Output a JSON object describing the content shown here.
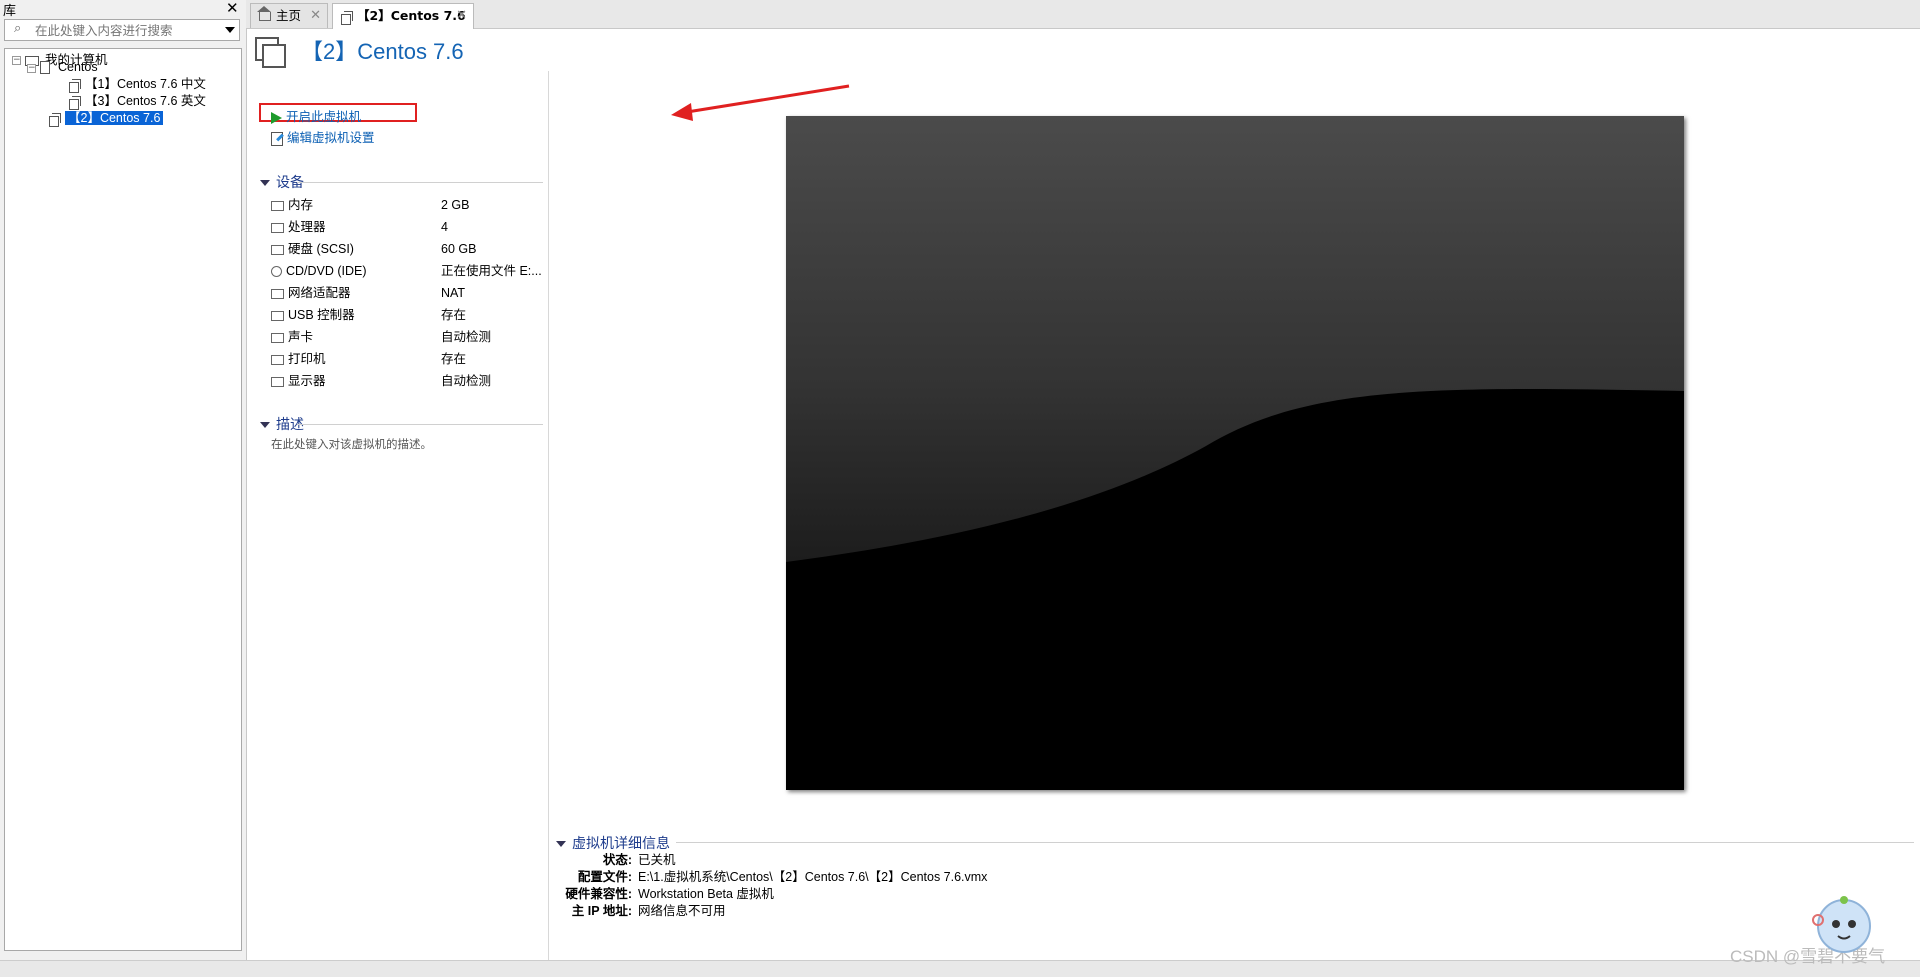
{
  "library": {
    "title": "库",
    "close": "✕",
    "search_placeholder": "在此处键入内容进行搜索",
    "tree": {
      "root": "我的计算机",
      "folder": "Centos",
      "children": [
        "【1】Centos 7.6 中文",
        "【3】Centos 7.6 英文"
      ],
      "selected": "【2】Centos 7.6"
    }
  },
  "tabs": [
    {
      "label": "主页",
      "close": "✕"
    },
    {
      "label": "【2】Centos 7.6",
      "close": "✕"
    }
  ],
  "vm": {
    "title": "【2】Centos 7.6",
    "actions": {
      "start": "开启此虚拟机",
      "edit": "编辑虚拟机设置"
    },
    "devices_heading": "设备",
    "devices": [
      {
        "name": "内存",
        "value": "2 GB",
        "icon": "memory-icon"
      },
      {
        "name": "处理器",
        "value": "4",
        "icon": "cpu-icon"
      },
      {
        "name": "硬盘 (SCSI)",
        "value": "60 GB",
        "icon": "disk-icon"
      },
      {
        "name": "CD/DVD (IDE)",
        "value": "正在使用文件 E:...",
        "icon": "cd-icon"
      },
      {
        "name": "网络适配器",
        "value": "NAT",
        "icon": "network-icon"
      },
      {
        "name": "USB 控制器",
        "value": "存在",
        "icon": "usb-icon"
      },
      {
        "name": "声卡",
        "value": "自动检测",
        "icon": "sound-icon"
      },
      {
        "name": "打印机",
        "value": "存在",
        "icon": "printer-icon"
      },
      {
        "name": "显示器",
        "value": "自动检测",
        "icon": "display-icon"
      }
    ],
    "description_heading": "描述",
    "description_placeholder": "在此处键入对该虚拟机的描述。",
    "details_heading": "虚拟机详细信息",
    "details": [
      {
        "key": "状态:",
        "value": "已关机"
      },
      {
        "key": "配置文件:",
        "value": "E:\\1.虚拟机系统\\Centos\\【2】Centos 7.6\\【2】Centos 7.6.vmx"
      },
      {
        "key": "硬件兼容性:",
        "value": "Workstation Beta 虚拟机"
      },
      {
        "key": "主 IP 地址:",
        "value": "网络信息不可用"
      }
    ]
  },
  "watermark": "CSDN @雪碧不要气",
  "colors": {
    "title_blue": "#1464b4",
    "selection_blue": "#0a64d6",
    "highlight_red": "#e02020",
    "play_green": "#1e9b2c"
  }
}
